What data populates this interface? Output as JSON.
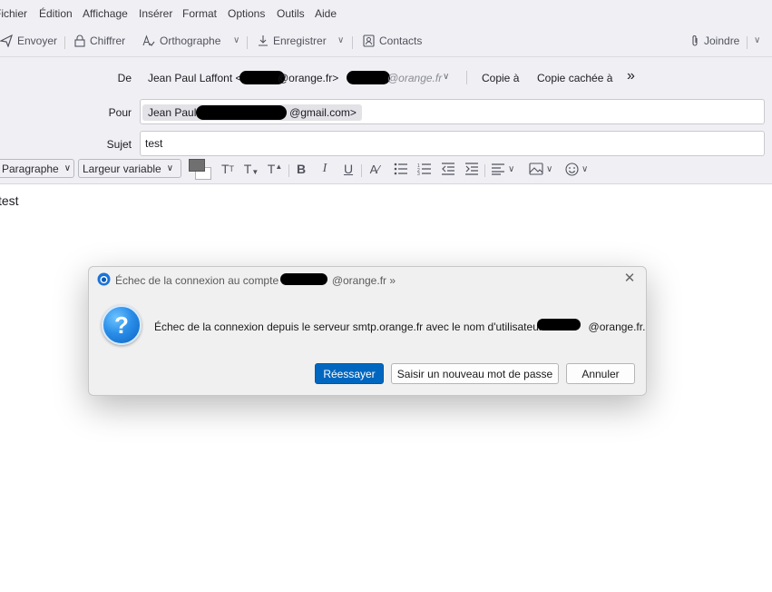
{
  "menu": {
    "items": [
      "Fichier",
      "Édition",
      "Affichage",
      "Insérer",
      "Format",
      "Options",
      "Outils",
      "Aide"
    ]
  },
  "toolbar": {
    "send": "Envoyer",
    "encrypt": "Chiffrer",
    "spelling": "Orthographe",
    "save": "Enregistrer",
    "contacts": "Contacts",
    "attach": "Joindre"
  },
  "header": {
    "from_label": "De",
    "from_name": "Jean Paul Laffont <",
    "from_domain": "@orange.fr>",
    "from_identity_domain": "@orange.fr",
    "cc": "Copie à",
    "bcc": "Copie cachée à",
    "more": "»",
    "to_label": "Pour",
    "to_name": "Jean Paul",
    "to_domain": "@gmail.com>",
    "subject_label": "Sujet",
    "subject_value": "test"
  },
  "format": {
    "paragraph": "Paragraphe",
    "font": "Largeur variable"
  },
  "body": {
    "text": "test"
  },
  "dialog": {
    "title_prefix": "Échec de la connexion au compte",
    "title_suffix": "@orange.fr »",
    "message_prefix": "Échec de la connexion depuis le serveur smtp.orange.fr avec le nom d'utilisateur",
    "message_suffix": "@orange.fr.",
    "retry": "Réessayer",
    "new_password": "Saisir un nouveau mot de passe",
    "cancel": "Annuler"
  },
  "colors": {
    "chrome": "#f0f0f4",
    "accent": "#0067c0",
    "dialog_bg": "#f0f0f0"
  }
}
